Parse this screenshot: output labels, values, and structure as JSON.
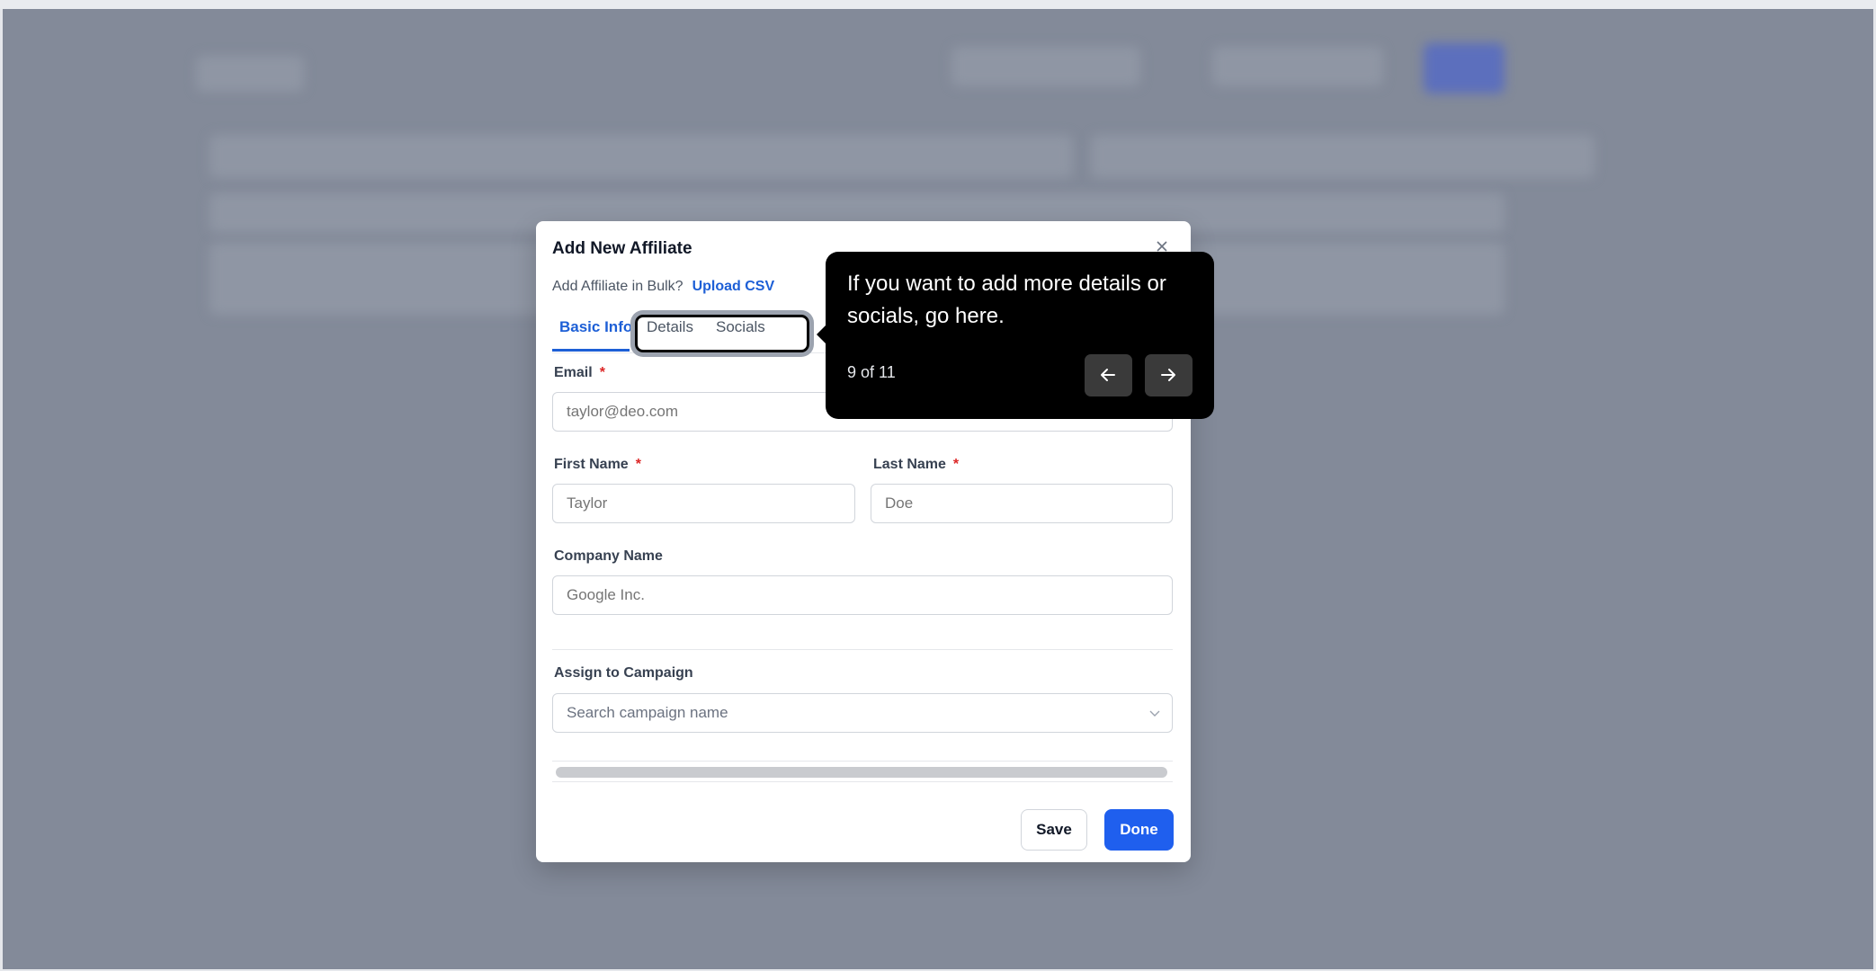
{
  "modal": {
    "title": "Add New Affiliate",
    "bulk_text": "Add Affiliate in Bulk?",
    "bulk_link": "Upload CSV",
    "tabs": [
      {
        "label": "Basic Info"
      },
      {
        "label": "Details"
      },
      {
        "label": "Socials"
      }
    ],
    "fields": {
      "email": {
        "label": "Email",
        "required": "*",
        "placeholder": "taylor@deo.com"
      },
      "first_name": {
        "label": "First Name",
        "required": "*",
        "placeholder": "Taylor"
      },
      "last_name": {
        "label": "Last Name",
        "required": "*",
        "placeholder": "Doe"
      },
      "company": {
        "label": "Company Name",
        "placeholder": "Google Inc."
      },
      "campaign": {
        "label": "Assign to Campaign",
        "placeholder": "Search campaign name"
      }
    },
    "save_label": "Save",
    "done_label": "Done"
  },
  "tooltip": {
    "text": "If you want to add more details or socials, go here.",
    "step": "9 of 11"
  },
  "colors": {
    "accent": "#1d5fd6",
    "primary_button": "#1f5fee",
    "backdrop": "#838a99",
    "required": "#dc2626"
  },
  "icons": [
    "close-icon",
    "chevron-down-icon",
    "arrow-left-icon",
    "arrow-right-icon"
  ]
}
